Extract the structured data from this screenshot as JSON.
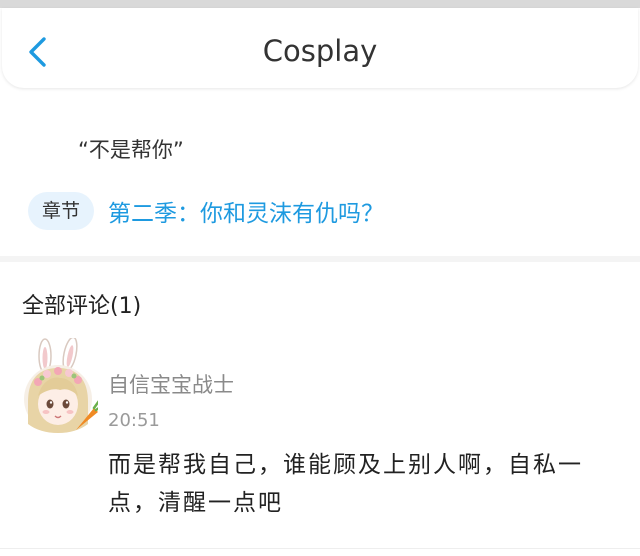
{
  "header": {
    "title": "Cosplay",
    "back_icon": "chevron-left-icon",
    "accent_color": "#1e9ae0"
  },
  "post": {
    "quote": "“不是帮你”",
    "chapter_badge": "章节",
    "chapter_title": "第二季：你和灵沫有仇吗？"
  },
  "comments": {
    "title": "全部评论(1)",
    "items": [
      {
        "avatar_icon": "bunny-girl-avatar-icon",
        "username": "自信宝宝战士",
        "time": "20:51",
        "text": "而是帮我自己，谁能顾及上别人啊，自私一点，清醒一点吧"
      }
    ]
  }
}
